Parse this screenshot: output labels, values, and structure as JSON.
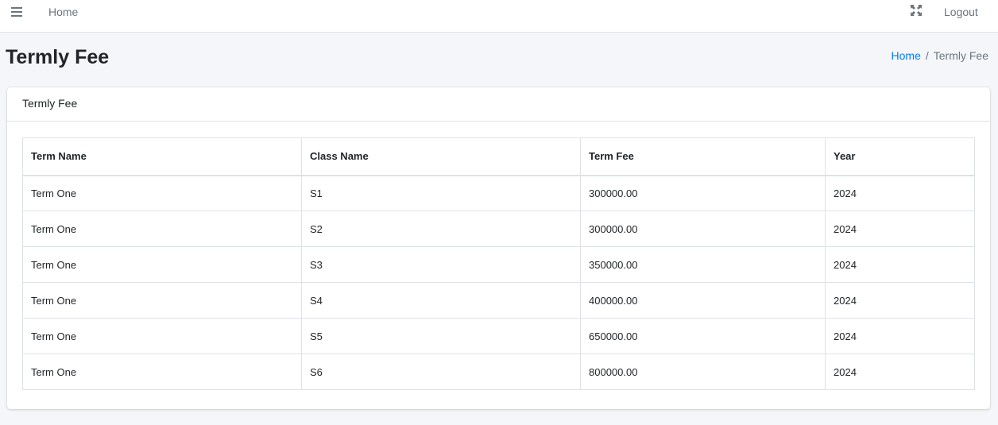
{
  "topbar": {
    "menu_icon": "hamburger-menu-icon",
    "home_label": "Home",
    "fullscreen_icon": "fullscreen-icon",
    "logout_label": "Logout"
  },
  "page": {
    "title": "Termly Fee",
    "breadcrumb": {
      "home": "Home",
      "separator": "/",
      "current": "Termly Fee"
    }
  },
  "card": {
    "title": "Termly Fee",
    "table": {
      "headers": [
        "Term Name",
        "Class Name",
        "Term Fee",
        "Year"
      ],
      "rows": [
        [
          "Term One",
          "S1",
          "300000.00",
          "2024"
        ],
        [
          "Term One",
          "S2",
          "300000.00",
          "2024"
        ],
        [
          "Term One",
          "S3",
          "350000.00",
          "2024"
        ],
        [
          "Term One",
          "S4",
          "400000.00",
          "2024"
        ],
        [
          "Term One",
          "S5",
          "650000.00",
          "2024"
        ],
        [
          "Term One",
          "S6",
          "800000.00",
          "2024"
        ]
      ]
    }
  },
  "colors": {
    "link": "#007bff",
    "muted": "#6c757d",
    "background": "#f4f6f9"
  }
}
